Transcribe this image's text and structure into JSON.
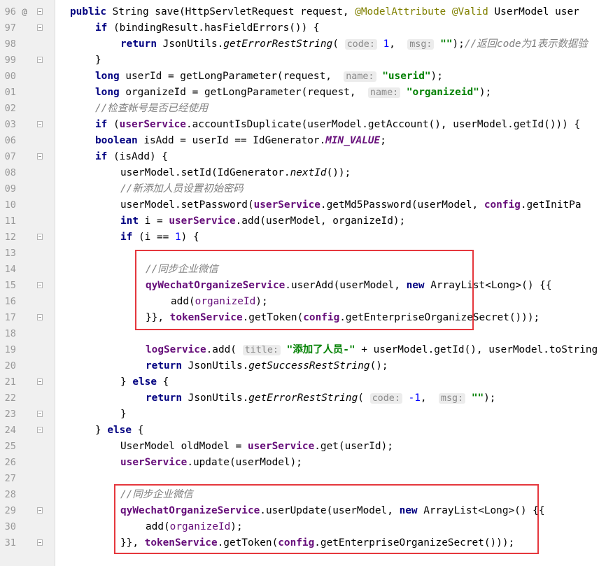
{
  "colors": {
    "keyword": "#000080",
    "field": "#660e7a",
    "string": "#008000",
    "number": "#0000ff",
    "comment": "#808080",
    "annotation": "#808000",
    "highlight_box": "#e5373d"
  },
  "gutter": {
    "override_marker": "@",
    "lines": [
      "96",
      "97",
      "98",
      "99",
      "00",
      "01",
      "02",
      "03",
      "06",
      "07",
      "08",
      "09",
      "10",
      "11",
      "12",
      "13",
      "14",
      "15",
      "16",
      "17",
      "18",
      "19",
      "20",
      "21",
      "22",
      "23",
      "24",
      "25",
      "26",
      "27",
      "28",
      "29",
      "30",
      "31"
    ]
  },
  "code": {
    "l96": {
      "t1": "public ",
      "t2": "String save(HttpServletRequest request, ",
      "t3": "@ModelAttribute @Valid ",
      "t4": "UserModel user"
    },
    "l97": {
      "t1": "if ",
      "t2": "(bindingResult.hasFieldErrors()) {"
    },
    "l98": {
      "t1": "return ",
      "t2": "JsonUtils.",
      "t3": "getErrorRestString",
      "t4": "( ",
      "h1": "code:",
      "t5": " ",
      "n1": "1",
      "t6": ",  ",
      "h2": "msg:",
      "t7": " ",
      "s1": "\"\"",
      "t8": ");",
      "c1": "//返回code为1表示数据验"
    },
    "l99": {
      "t1": "}"
    },
    "l00": {
      "t1": "long ",
      "t2": "userId = getLongParameter(request,  ",
      "h1": "name:",
      "t3": " ",
      "s1": "\"userid\"",
      "t4": ");"
    },
    "l01": {
      "t1": "long ",
      "t2": "organizeId = getLongParameter(request,  ",
      "h1": "name:",
      "t3": " ",
      "s1": "\"organizeid\"",
      "t4": ");"
    },
    "l02": {
      "c1": "//检查帐号是否已经使用"
    },
    "l03": {
      "t1": "if ",
      "t2": "(",
      "f1": "userService",
      "t3": ".accountIsDuplicate(userModel.getAccount(), userModel.getId())) {"
    },
    "l06": {
      "t1": "boolean ",
      "t2": "isAdd = userId == IdGenerator.",
      "f1": "MIN_VALUE",
      "t3": ";"
    },
    "l07": {
      "t1": "if ",
      "t2": "(isAdd) {"
    },
    "l08": {
      "t1": "userModel.setId(IdGenerator.",
      "i1": "nextId",
      "t2": "());"
    },
    "l09": {
      "c1": "//新添加人员设置初始密码"
    },
    "l10": {
      "t1": "userModel.setPassword(",
      "f1": "userService",
      "t2": ".getMd5Password(userModel, ",
      "f2": "config",
      "t3": ".getInitPa"
    },
    "l11": {
      "t1": "int ",
      "t2": "i = ",
      "f1": "userService",
      "t3": ".add(userModel, organizeId);"
    },
    "l12": {
      "t1": "if ",
      "t2": "(i == ",
      "n1": "1",
      "t3": ") {"
    },
    "l14": {
      "c1": "//同步企业微信"
    },
    "l15": {
      "f1": "qyWechatOrganizeService",
      "t1": ".userAdd(userModel, ",
      "t2": "new ",
      "t3": "ArrayList<Long>() {{"
    },
    "l16": {
      "t1": "add(",
      "f1": "organizeId",
      "t2": ");"
    },
    "l17": {
      "t1": "}}, ",
      "f1": "tokenService",
      "t2": ".getToken(",
      "f2": "config",
      "t3": ".getEnterpriseOrganizeSecret()));"
    },
    "l19": {
      "f1": "logService",
      "t1": ".add( ",
      "h1": "title:",
      "t2": " ",
      "s1": "\"添加了人员-\"",
      "t3": " + userModel.getId(), userModel.toString"
    },
    "l20": {
      "t1": "return ",
      "t2": "JsonUtils.",
      "i1": "getSuccessRestString",
      "t3": "();"
    },
    "l21": {
      "t1": "} ",
      "t2": "else ",
      "t3": "{"
    },
    "l22": {
      "t1": "return ",
      "t2": "JsonUtils.",
      "i1": "getErrorRestString",
      "t3": "( ",
      "h1": "code:",
      "t4": " ",
      "n1": "-1",
      "t5": ",  ",
      "h2": "msg:",
      "t6": " ",
      "s1": "\"\"",
      "t7": ");"
    },
    "l23": {
      "t1": "}"
    },
    "l24": {
      "t1": "} ",
      "t2": "else ",
      "t3": "{"
    },
    "l25": {
      "t1": "UserModel oldModel = ",
      "f1": "userService",
      "t2": ".get(userId);"
    },
    "l26": {
      "f1": "userService",
      "t1": ".update(userModel);"
    },
    "l28": {
      "c1": "//同步企业微信"
    },
    "l29": {
      "f1": "qyWechatOrganizeService",
      "t1": ".userUpdate(userModel, ",
      "t2": "new ",
      "t3": "ArrayList<Long>() {{"
    },
    "l30": {
      "t1": "add(",
      "f1": "organizeId",
      "t2": ");"
    },
    "l31": {
      "t1": "}}, ",
      "f1": "tokenService",
      "t2": ".getToken(",
      "f2": "config",
      "t3": ".getEnterpriseOrganizeSecret()));"
    }
  }
}
